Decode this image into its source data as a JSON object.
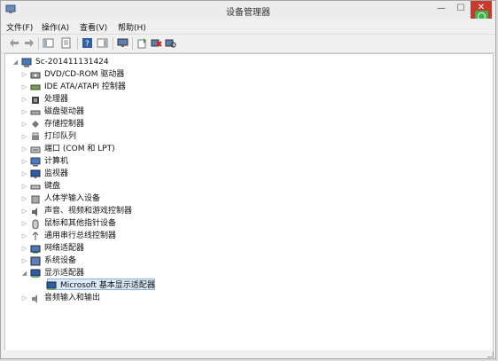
{
  "window": {
    "title": "设备管理器",
    "close_glyph": "✕",
    "min_glyph": "—",
    "max_glyph": "☐"
  },
  "menu": {
    "items": [
      {
        "label": "文件(F)"
      },
      {
        "label": "操作(A)"
      },
      {
        "label": "查看(V)"
      },
      {
        "label": "帮助(H)"
      }
    ]
  },
  "toolbar": {
    "buttons": [
      {
        "icon": "back-arrow-icon"
      },
      {
        "icon": "forward-arrow-icon"
      },
      {
        "icon": "show-hide-tree-icon"
      },
      {
        "icon": "properties-icon"
      },
      {
        "icon": "help-icon"
      },
      {
        "icon": "action-pane-icon"
      },
      {
        "icon": "display-device-icon"
      },
      {
        "icon": "update-driver-icon"
      },
      {
        "icon": "uninstall-icon"
      },
      {
        "icon": "scan-hardware-icon"
      }
    ]
  },
  "tree": {
    "root": {
      "label": "Sc-201411131424",
      "expander": "◢",
      "icon": "computer-icon"
    },
    "items": [
      {
        "label": "DVD/CD-ROM 驱动器",
        "expander": "▷",
        "icon": "dvd-drive-icon"
      },
      {
        "label": "IDE ATA/ATAPI 控制器",
        "expander": "▷",
        "icon": "ide-controller-icon"
      },
      {
        "label": "处理器",
        "expander": "▷",
        "icon": "processor-icon"
      },
      {
        "label": "磁盘驱动器",
        "expander": "▷",
        "icon": "disk-drive-icon"
      },
      {
        "label": "存储控制器",
        "expander": "▷",
        "icon": "storage-controller-icon"
      },
      {
        "label": "打印队列",
        "expander": "▷",
        "icon": "printer-icon"
      },
      {
        "label": "端口 (COM 和 LPT)",
        "expander": "▷",
        "icon": "port-icon"
      },
      {
        "label": "计算机",
        "expander": "▷",
        "icon": "computer-icon"
      },
      {
        "label": "监视器",
        "expander": "▷",
        "icon": "monitor-icon"
      },
      {
        "label": "键盘",
        "expander": "▷",
        "icon": "keyboard-icon"
      },
      {
        "label": "人体学输入设备",
        "expander": "▷",
        "icon": "hid-icon"
      },
      {
        "label": "声音、视频和游戏控制器",
        "expander": "▷",
        "icon": "sound-icon"
      },
      {
        "label": "鼠标和其他指针设备",
        "expander": "▷",
        "icon": "mouse-icon"
      },
      {
        "label": "通用串行总线控制器",
        "expander": "▷",
        "icon": "usb-icon"
      },
      {
        "label": "网络适配器",
        "expander": "▷",
        "icon": "network-adapter-icon"
      },
      {
        "label": "系统设备",
        "expander": "▷",
        "icon": "system-device-icon"
      },
      {
        "label": "显示适配器",
        "expander": "◢",
        "icon": "display-adapter-icon"
      },
      {
        "label": "Microsoft 基本显示适配器",
        "expander": "",
        "icon": "display-adapter-icon",
        "child": true,
        "selected": true
      },
      {
        "label": "音频输入和输出",
        "expander": "▷",
        "icon": "audio-io-icon"
      }
    ]
  },
  "colors": {
    "close_button": "#c73b2e",
    "selection": "#dbe9f6",
    "badge": "#3db34a"
  }
}
